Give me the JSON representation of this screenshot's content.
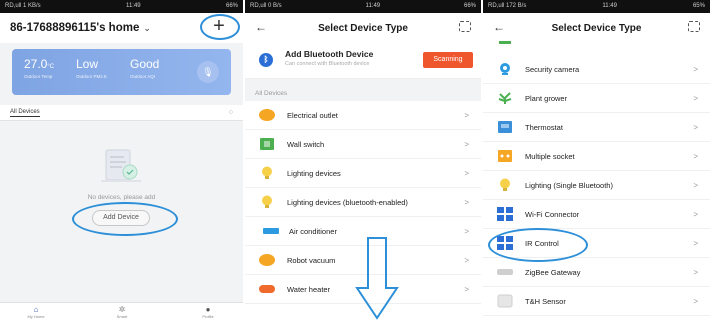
{
  "screen1": {
    "status": {
      "left": "RD,ull 1 KB/s",
      "center": "11:49",
      "right": "66%"
    },
    "home_title": "86-17688896115's home",
    "add_symbol": "+",
    "weather": {
      "temp": "27.0",
      "temp_unit": "°C",
      "temp_label": "Outdoor Temp",
      "pm_value": "Low",
      "pm_label": "Outdoor PM2.5",
      "aqi_value": "Good",
      "aqi_label": "Outdoor AQI"
    },
    "tab_all": "All Devices",
    "empty_text": "No devices, please add",
    "add_device_label": "Add Device",
    "bottom_nav": [
      {
        "label": "My Home",
        "icon": "home-icon"
      },
      {
        "label": "Smart",
        "icon": "sun-icon"
      },
      {
        "label": "Profile",
        "icon": "profile-icon"
      }
    ]
  },
  "screen2": {
    "status": {
      "left": "RD,ull 0 B/s",
      "center": "11:49",
      "right": "66%"
    },
    "title": "Select Device Type",
    "bluetooth": {
      "title": "Add Bluetooth Device",
      "subtitle": "Can connect with Bluetooth device",
      "button": "Scanning"
    },
    "section_label": "All Devices",
    "devices": [
      {
        "name": "Electrical outlet",
        "icon": "outlet-icon",
        "color": "#f5a623"
      },
      {
        "name": "Wall switch",
        "icon": "switch-icon",
        "color": "#4caf50"
      },
      {
        "name": "Lighting devices",
        "icon": "bulb-icon",
        "color": "#f7d04a"
      },
      {
        "name": "Lighting devices (bluetooth-enabled)",
        "icon": "bulb-icon",
        "color": "#f7d04a"
      },
      {
        "name": "Air conditioner",
        "icon": "ac-icon",
        "color": "#2b9ae0"
      },
      {
        "name": "Robot vacuum",
        "icon": "vacuum-icon",
        "color": "#f5a623"
      },
      {
        "name": "Water heater",
        "icon": "heater-icon",
        "color": "#f06a2e"
      }
    ]
  },
  "screen3": {
    "status": {
      "left": "RD,ull 172 B/s",
      "center": "11:49",
      "right": "65%"
    },
    "title": "Select Device Type",
    "devices": [
      {
        "name": "Security camera",
        "icon": "camera-icon",
        "color": "#2b9ae0"
      },
      {
        "name": "Plant grower",
        "icon": "plant-icon",
        "color": "#4caf50"
      },
      {
        "name": "Thermostat",
        "icon": "thermostat-icon",
        "color": "#3a8fd8"
      },
      {
        "name": "Multiple socket",
        "icon": "socket-icon",
        "color": "#f5a623"
      },
      {
        "name": "Lighting (Single Bluetooth)",
        "icon": "bulb-icon",
        "color": "#f7d04a"
      },
      {
        "name": "Wi-Fi Connector",
        "icon": "wifi-connector-icon",
        "color": "#2b6fd6"
      },
      {
        "name": "IR Control",
        "icon": "ir-control-icon",
        "color": "#2b6fd6"
      },
      {
        "name": "ZigBee Gateway",
        "icon": "gateway-icon",
        "color": "#cfcfcf"
      },
      {
        "name": "T&H Sensor",
        "icon": "sensor-icon",
        "color": "#e0e0e0"
      }
    ],
    "chevron": ">"
  }
}
